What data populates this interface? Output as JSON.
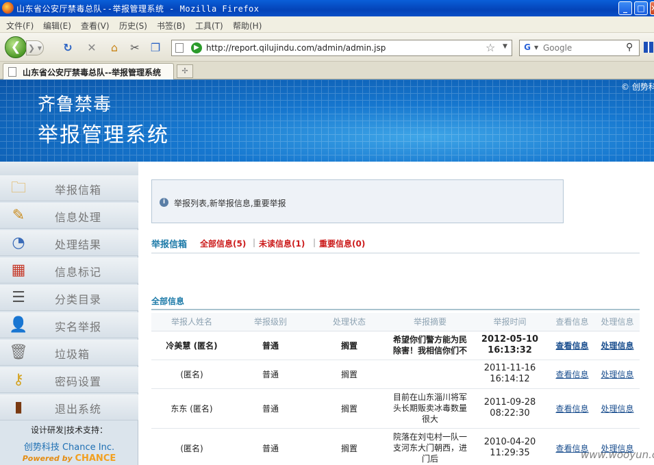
{
  "window": {
    "title": "山东省公安厅禁毒总队--举报管理系统 - Mozilla Firefox",
    "minimize": "_",
    "maximize": "□",
    "close": "✕"
  },
  "menu": [
    "文件(F)",
    "编辑(E)",
    "查看(V)",
    "历史(S)",
    "书签(B)",
    "工具(T)",
    "帮助(H)"
  ],
  "nav": {
    "url": "http://report.qilujindu.com/admin/admin.jsp",
    "search_placeholder": "Google"
  },
  "tab": {
    "label": "山东省公安厅禁毒总队--举报管理系统"
  },
  "banner": {
    "brand1": "齐鲁禁毒",
    "brand2": "举报管理系统",
    "copyright": "© 创势科"
  },
  "sidebar": {
    "items": [
      {
        "label": "举报信箱",
        "icon": "folder-icon"
      },
      {
        "label": "信息处理",
        "icon": "pencil-icon"
      },
      {
        "label": "处理结果",
        "icon": "chart-icon"
      },
      {
        "label": "信息标记",
        "icon": "calendar-icon"
      },
      {
        "label": "分类目录",
        "icon": "list-icon"
      },
      {
        "label": "实名举报",
        "icon": "user-icon"
      },
      {
        "label": "垃圾箱",
        "icon": "trash-icon"
      },
      {
        "label": "密码设置",
        "icon": "key-icon"
      },
      {
        "label": "退出系统",
        "icon": "door-icon"
      }
    ],
    "footer": {
      "line1": "设计研发|技术支持：",
      "line2": "创势科技 Chance Inc.",
      "line3_prefix": "Powered by",
      "line3_brand": "CHANCE"
    }
  },
  "main": {
    "info": "举报列表,新举报信息,重要举报",
    "tabs": {
      "main": "举报信箱",
      "all": "全部信息(5)",
      "unread": "未读信息(1)",
      "important": "重要信息(0)",
      "sep": "|"
    },
    "section_title": "全部信息",
    "columns": [
      "举报人姓名",
      "举报级别",
      "处理状态",
      "举报摘要",
      "举报时间",
      "查看信息",
      "处理信息"
    ],
    "rows": [
      {
        "name": "冷美慧 (匿名)",
        "level": "普通",
        "status": "搁置",
        "summary": "希望你们警方能为民除害！我相信你们不",
        "time": "2012-05-10 16:13:32",
        "view": "查看信息",
        "handle": "处理信息",
        "unread": true
      },
      {
        "name": "(匿名)",
        "level": "普通",
        "status": "搁置",
        "summary": "",
        "time": "2011-11-16 16:14:12",
        "view": "查看信息",
        "handle": "处理信息",
        "unread": false
      },
      {
        "name": "东东 (匿名)",
        "level": "普通",
        "status": "搁置",
        "summary": "目前在山东淄川将军头长期贩卖冰毒数量很大",
        "time": "2011-09-28 08:22:30",
        "view": "查看信息",
        "handle": "处理信息",
        "unread": false
      },
      {
        "name": "(匿名)",
        "level": "普通",
        "status": "搁置",
        "summary": "院落在刘屯村一队一支河东大门朝西，进门后",
        "time": "2010-04-20 11:29:35",
        "view": "查看信息",
        "handle": "处理信息",
        "unread": false
      }
    ]
  },
  "watermark": "www.wooyun.org"
}
